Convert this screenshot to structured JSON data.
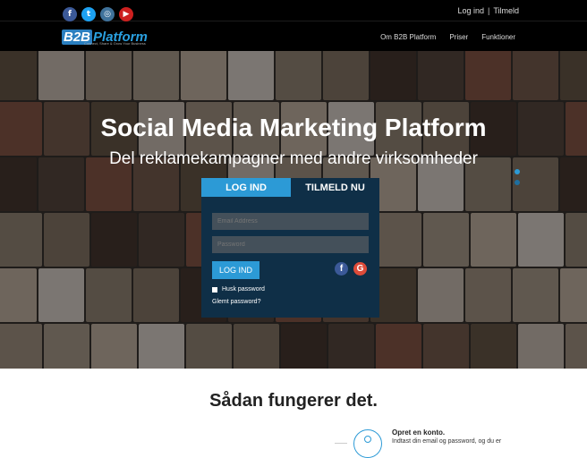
{
  "header": {
    "social": [
      {
        "name": "facebook",
        "glyph": "f"
      },
      {
        "name": "twitter",
        "glyph": "t"
      },
      {
        "name": "instagram",
        "glyph": "◎"
      },
      {
        "name": "youtube",
        "glyph": "▶"
      }
    ],
    "login_link": "Log ind",
    "separator": "|",
    "signup_link": "Tilmeld",
    "logo_mark": "B2B",
    "logo_word": "Platform",
    "logo_tagline": "Connect, Share & Grow Your Business",
    "nav": [
      "Om B2B Platform",
      "Priser",
      "Funktioner"
    ]
  },
  "hero": {
    "title": "Social Media Marketing Platform",
    "subtitle": "Del reklamekampagner med andre virksomheder"
  },
  "login_form": {
    "tab_login": "LOG IND",
    "tab_signup": "TILMELD NU",
    "email_placeholder": "Email Address",
    "password_placeholder": "Password",
    "submit_label": "LOG IND",
    "remember_label": "Husk password",
    "forgot_label": "Glemt password?",
    "facebook_glyph": "f",
    "google_glyph": "G"
  },
  "how": {
    "title": "Sådan fungerer det.",
    "step1_title": "Opret en konto.",
    "step1_text": "Indtast din email og password, og du er"
  },
  "colors": {
    "accent": "#2c9ad6",
    "panel": "#0f2f47",
    "topbar": "#000000"
  }
}
